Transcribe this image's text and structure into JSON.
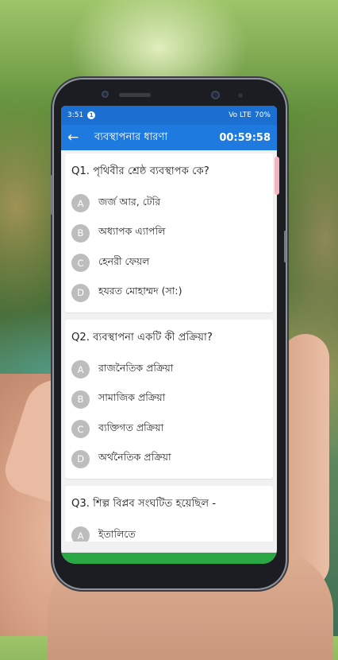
{
  "status": {
    "time": "3:51",
    "notification_badge": "1",
    "signal": "Vo LTE",
    "battery": "70%"
  },
  "appbar": {
    "back_icon": "←",
    "title": "ব্যবস্থাপনার ধারণা",
    "timer": "00:59:58"
  },
  "questions": [
    {
      "text": "Q1. পৃথিবীর শ্রেষ্ঠ ব্যবস্থাপক কে?",
      "options": [
        {
          "key": "A",
          "text": "জর্জ আর, টেরি"
        },
        {
          "key": "B",
          "text": "অধ্যাপক এ্যাপলি"
        },
        {
          "key": "C",
          "text": "হেনরী ফেয়ল"
        },
        {
          "key": "D",
          "text": "হযরত মোহাম্মদ (সা:)"
        }
      ]
    },
    {
      "text": "Q2. ব্যবস্থাপনা একটি কী প্রক্রিয়া?",
      "options": [
        {
          "key": "A",
          "text": "রাজনৈতিক প্রক্রিয়া"
        },
        {
          "key": "B",
          "text": "সামাজিক প্রক্রিয়া"
        },
        {
          "key": "C",
          "text": "ব্যক্তিগত প্রক্রিয়া"
        },
        {
          "key": "D",
          "text": "অর্থনৈতিক প্রক্রিয়া"
        }
      ]
    },
    {
      "text": "Q3. শিল্প বিপ্লব সংঘটিত হয়েছিল -",
      "options": [
        {
          "key": "A",
          "text": "ইতালিতে"
        }
      ]
    }
  ],
  "colors": {
    "statusbar": "#1a6fd1",
    "appbar": "#1f7ae0",
    "bottombar": "#2aa846",
    "option_circle": "#bdbdbd"
  }
}
